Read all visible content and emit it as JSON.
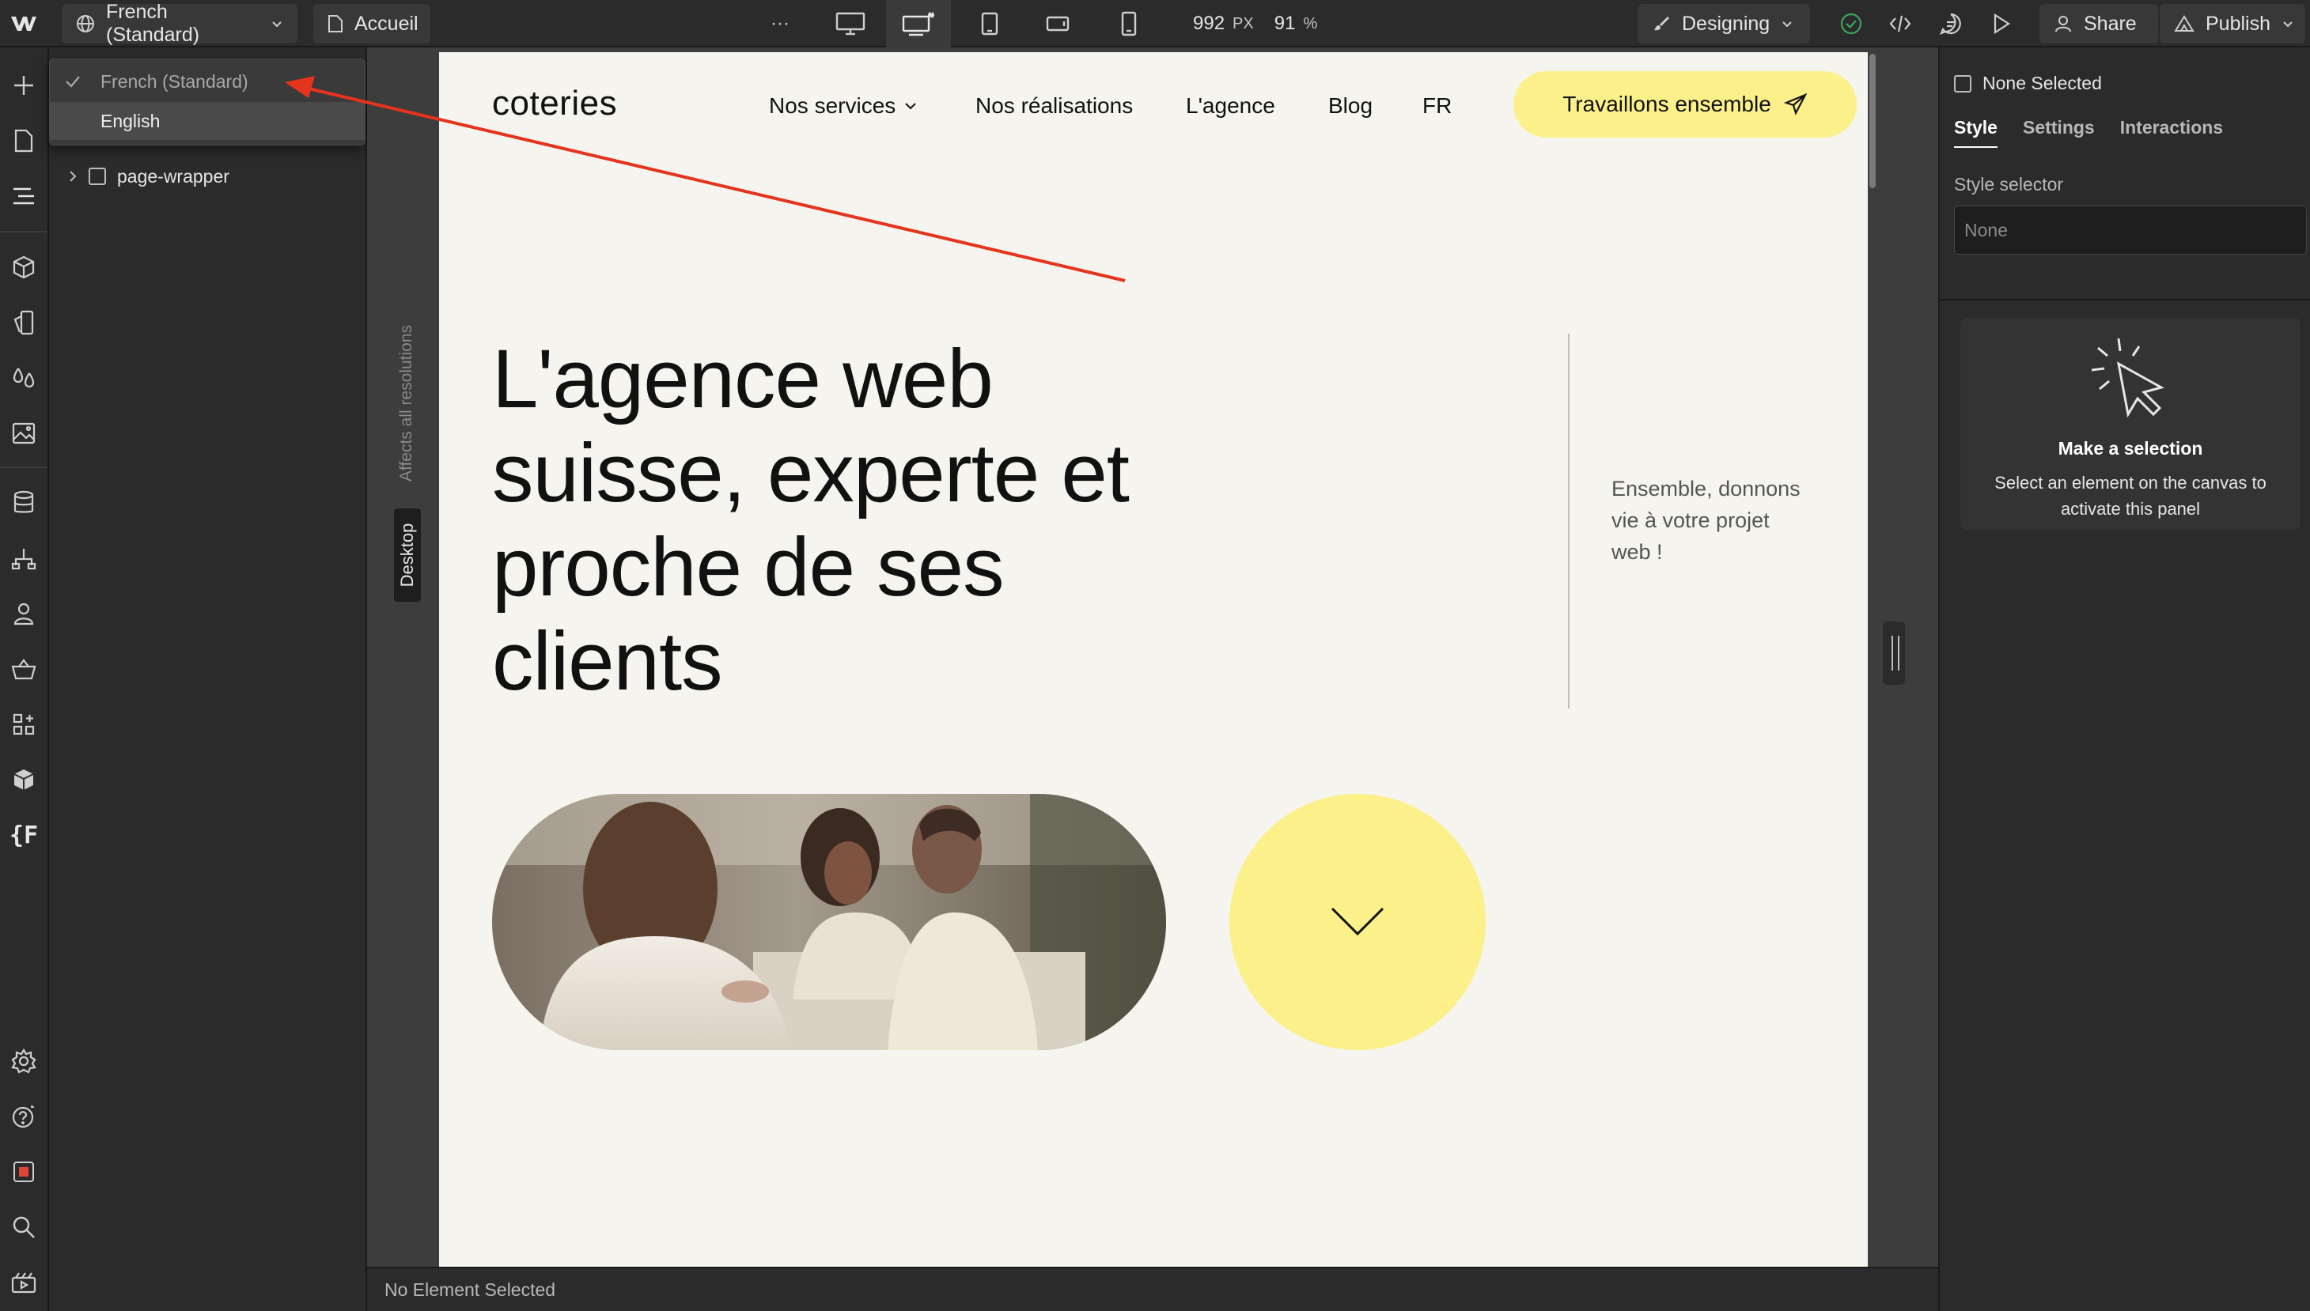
{
  "topbar": {
    "locale_button": "French (Standard)",
    "page_button": "Accueil",
    "more_label": "···",
    "width_value": "992",
    "width_unit": "PX",
    "zoom_value": "91",
    "zoom_unit": "%",
    "mode_button": "Designing",
    "share_button": "Share",
    "publish_button": "Publish"
  },
  "locale_menu": {
    "items": [
      {
        "label": "French (Standard)",
        "selected": true
      },
      {
        "label": "English",
        "selected": false
      }
    ]
  },
  "navigator": {
    "tree": [
      {
        "label": "page-wrapper"
      }
    ]
  },
  "canvas": {
    "breakpoint_label": "Desktop",
    "affects_label": "Affects all resolutions",
    "status": "No Element Selected"
  },
  "site": {
    "logo": "coteries",
    "nav": {
      "services": "Nos services",
      "works": "Nos réalisations",
      "agency": "L'agence",
      "blog": "Blog",
      "lang": "FR"
    },
    "cta": "Travaillons ensemble",
    "hero": {
      "line1": "L'agence web",
      "line2": "suisse, experte et",
      "line3": "proche de ses",
      "line4": "clients"
    },
    "tagline": {
      "line1": "Ensemble, donnons",
      "line2": "vie à votre projet",
      "line3": "web !"
    },
    "accent_color": "#fbf089"
  },
  "right_panel": {
    "selection": "None Selected",
    "tabs": [
      "Style",
      "Settings",
      "Interactions"
    ],
    "active_tab": "Style",
    "style_selector_label": "Style selector",
    "style_selector_placeholder": "None",
    "empty_title": "Make a selection",
    "empty_desc": "Select an element on the canvas to activate this panel"
  },
  "annotation_color": "#e5341d"
}
